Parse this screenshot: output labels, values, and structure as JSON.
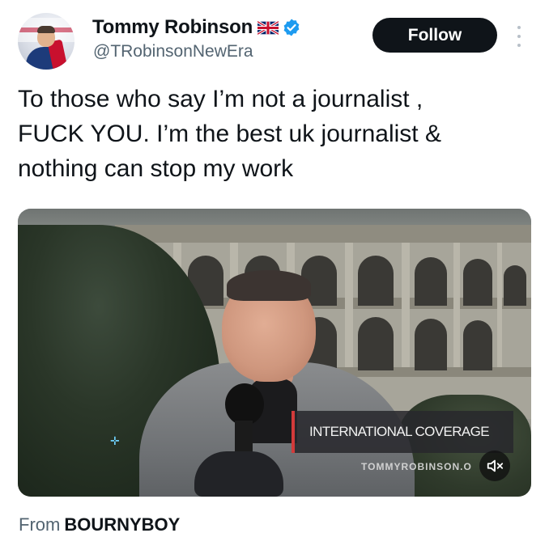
{
  "author": {
    "display_name": "Tommy Robinson",
    "handle": "@TRobinsonNewEra",
    "flag_icon": "uk-flag-icon",
    "verified_icon": "verified-badge-icon",
    "verified_color": "#1d9bf0"
  },
  "actions": {
    "follow_label": "Follow",
    "more_icon": "more-vertical-icon"
  },
  "tweet": {
    "lines": [
      "To those who say I’m not a journalist ,",
      "FUCK YOU. I’m the best uk journalist &",
      "nothing can stop my work"
    ]
  },
  "video": {
    "overlay_title": "INTERNATIONAL COVERAGE",
    "watermark": "TOMMYROBINSON.O",
    "mute_icon": "muted-speaker-icon"
  },
  "source": {
    "prefix": "From",
    "name": "BOURNYBOY"
  },
  "colors": {
    "text_primary": "#0f1419",
    "text_secondary": "#536471",
    "follow_bg": "#0f1419",
    "overlay_accent": "#d23a3a"
  }
}
